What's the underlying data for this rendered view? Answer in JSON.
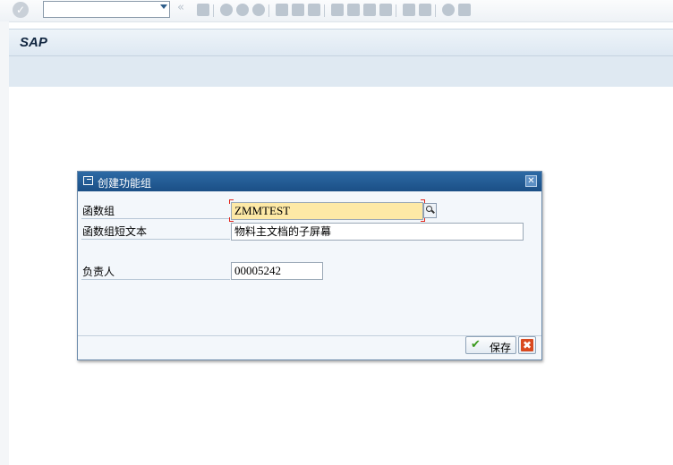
{
  "toolbar": {
    "command_field_value": "",
    "icons": [
      "enter-icon",
      "save-icon",
      "back-icon",
      "exit-icon",
      "cancel-icon",
      "print-icon",
      "find-icon",
      "find-next-icon",
      "first-page-icon",
      "previous-page-icon",
      "next-page-icon",
      "last-page-icon",
      "create-session-icon",
      "shortcut-icon",
      "help-icon",
      "layout-menu-icon"
    ]
  },
  "title": {
    "text": "SAP"
  },
  "dialog": {
    "title": "创建功能组",
    "fields": {
      "function_group": {
        "label": "函数组",
        "value": "ZMMTEST"
      },
      "short_text": {
        "label": "函数组短文本",
        "value": "物料主文档的子屏幕"
      },
      "person_responsible": {
        "label": "负责人",
        "value": "00005242"
      }
    },
    "buttons": {
      "save_label": "保存"
    }
  },
  "colors": {
    "dialog_title_bg": "#1f5a95",
    "required_field_bg": "#fde9a6",
    "save_check": "#3a9a1d",
    "cancel_red": "#d9491f"
  }
}
